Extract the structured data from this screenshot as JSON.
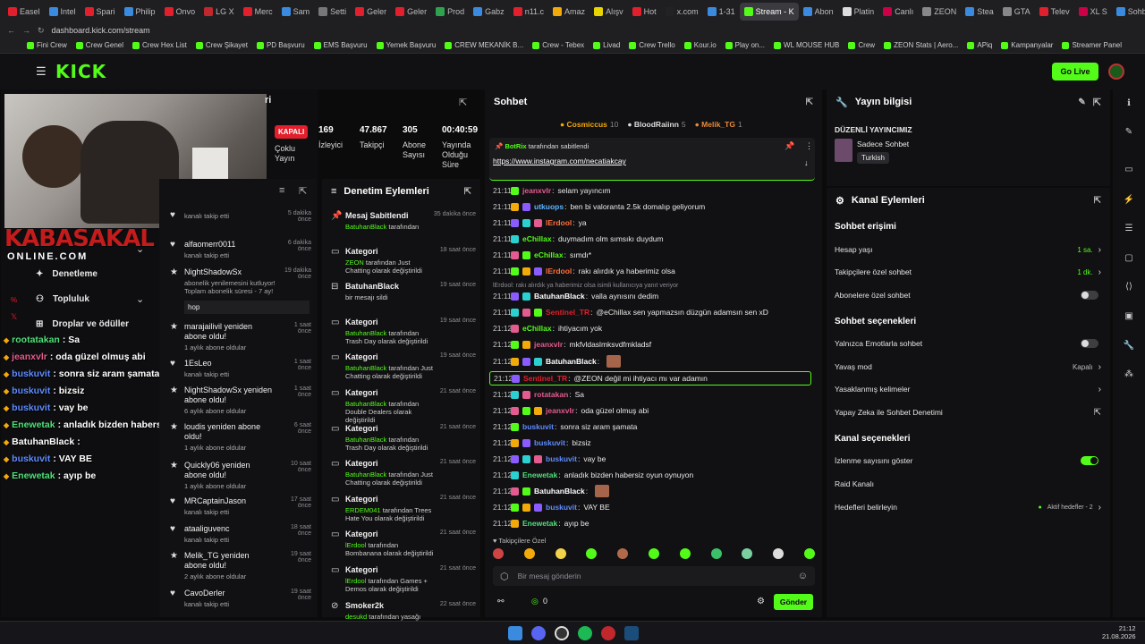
{
  "browser": {
    "tabs": [
      "Easel",
      "Intel",
      "Spari",
      "Philip",
      "Onvo",
      "LG X",
      "Merc",
      "Sam",
      "Setti",
      "Geler",
      "Geler",
      "Prod",
      "Gabz",
      "n11.c",
      "Amaz",
      "Alışv",
      "Hot",
      "x.com",
      "1-31",
      "Stream - K",
      "Abon",
      "Platin",
      "Canlı",
      "ZEON",
      "Stea",
      "GTA",
      "Telev",
      "XL S",
      "Sohb"
    ],
    "active_tab": "Stream - K",
    "url": "dashboard.kick.com/stream",
    "bookmarks": [
      "Fini Crew",
      "Crew Genel",
      "Crew Hex List",
      "Crew Şikayet",
      "PD Başvuru",
      "EMS Başvuru",
      "Yemek Başvuru",
      "CREW MEKANİK B...",
      "Crew - Tebex",
      "Livad",
      "Crew Trello",
      "Kour.io",
      "Play on...",
      "WL MOUSE HUB",
      "Crew",
      "ZEON Stats | Aero...",
      "APiq",
      "Kampanyalar",
      "Streamer Panel"
    ]
  },
  "header": {
    "logo": "KICK",
    "go_live": "Go Live"
  },
  "stream_stats": {
    "status": "KAPALI",
    "status_label": "Çoklu Yayın",
    "viewers": "169",
    "viewers_label": "İzleyici",
    "followers": "47.867",
    "followers_label": "Takipçi",
    "subs": "305",
    "subs_label": "Abone Sayısı",
    "duration": "00:40:59",
    "duration_label": "Yayında Olduğu Süre"
  },
  "sidebar": {
    "items": [
      "Denetleme",
      "Topluluk",
      "Droplar ve ödüller"
    ]
  },
  "activity_feed": [
    {
      "title": "",
      "sub": "kanalı takip etti",
      "time": "5 dakika önce"
    },
    {
      "title": "alfaomerr0011",
      "sub": "kanalı takip etti",
      "time": "6 dakika önce"
    },
    {
      "title": "NightShadowSx",
      "sub": "abonelik yenilemesini kutluyor! Toplam abonelik süresi - 7 ay!",
      "time": "19 dakika önce",
      "msg": "hop"
    },
    {
      "title": "marajailivil yeniden abone oldu!",
      "sub": "1 aylık abone oldular",
      "time": "1 saat önce"
    },
    {
      "title": "1EsLeo",
      "sub": "kanalı takip etti",
      "time": "1 saat önce"
    },
    {
      "title": "NightShadowSx yeniden abone oldu!",
      "sub": "6 aylık abone oldular",
      "time": "1 saat önce"
    },
    {
      "title": "loudis yeniden abone oldu!",
      "sub": "1 aylık abone oldular",
      "time": "6 saat önce"
    },
    {
      "title": "Quickly06 yeniden abone oldu!",
      "sub": "1 aylık abone oldular",
      "time": "10 saat önce"
    },
    {
      "title": "MRCaptainJason",
      "sub": "kanalı takip etti",
      "time": "17 saat önce"
    },
    {
      "title": "ataaliguvenc",
      "sub": "kanalı takip etti",
      "time": "18 saat önce"
    },
    {
      "title": "Melik_TG yeniden abone oldu!",
      "sub": "2 aylık abone oldular",
      "time": "19 saat önce"
    },
    {
      "title": "CavoDerler",
      "sub": "kanalı takip etti",
      "time": "19 saat önce"
    }
  ],
  "moderation": {
    "title": "Denetim Eylemleri",
    "items": [
      {
        "title": "Mesaj Sabitlendi",
        "user": "BatuhanBlack",
        "rest": " tarafından",
        "time": "35 dakika önce"
      },
      {
        "title": "Kategori",
        "user": "ZEON",
        "rest": " tarafından Just Chatting olarak değiştirildi",
        "time": "18 saat önce"
      },
      {
        "title": "BatuhanBlack",
        "user": "",
        "rest": "bir mesajı sildi",
        "time": "19 saat önce"
      },
      {
        "title": "Kategori",
        "user": "BatuhanBlack",
        "rest": " tarafından Trash Day olarak değiştirildi",
        "time": "19 saat önce"
      },
      {
        "title": "Kategori",
        "user": "BatuhanBlack",
        "rest": " tarafından Just Chatting olarak değiştirildi",
        "time": "19 saat önce"
      },
      {
        "title": "Kategori",
        "user": "BatuhanBlack",
        "rest": " tarafından Double Dealers olarak değiştirildi",
        "time": "21 saat önce"
      },
      {
        "title": "Kategori",
        "user": "BatuhanBlack",
        "rest": " tarafından Trash Day olarak değiştirildi",
        "time": "21 saat önce"
      },
      {
        "title": "Kategori",
        "user": "BatuhanBlack",
        "rest": " tarafından Just Chatting olarak değiştirildi",
        "time": "21 saat önce"
      },
      {
        "title": "Kategori",
        "user": "ERDEM041",
        "rest": " tarafından Trees Hate You olarak değiştirildi",
        "time": "21 saat önce"
      },
      {
        "title": "Kategori",
        "user": "lErdool",
        "rest": " tarafından Bombanana olarak değiştirildi",
        "time": "21 saat önce"
      },
      {
        "title": "Kategori",
        "user": "lErdool",
        "rest": " tarafından Games + Demos olarak değiştirildi",
        "time": "21 saat önce"
      },
      {
        "title": "Smoker2k",
        "user": "desukd",
        "rest": " tarafından yasağı kaldırıldı",
        "time": "22 saat önce"
      }
    ]
  },
  "chat": {
    "title": "Sohbet",
    "top_gifters": [
      {
        "name": "Cosmiccus",
        "count": "10"
      },
      {
        "name": "BloodRaiinn",
        "count": "5"
      },
      {
        "name": "Melik_TG",
        "count": "1"
      }
    ],
    "pinned": {
      "by": "BotRix",
      "by_suffix": "tarafından sabitlendi",
      "link": "https://www.instagram.com/necatiakcay"
    },
    "messages": [
      {
        "time": "21:11",
        "user": "jeanxvlr",
        "color": "#e45b8f",
        "text": "selam yayıncım"
      },
      {
        "time": "21:11",
        "user": "utkuops",
        "color": "#5eb3ff",
        "text": "ben bi valoranta 2.5k domalıp geliyorum"
      },
      {
        "time": "21:11",
        "user": "lErdool",
        "color": "#ff6f3c",
        "text": "ya"
      },
      {
        "time": "21:11",
        "user": "eChillax",
        "color": "#53fc18",
        "text": "duymadım olm sımsıkı duydum"
      },
      {
        "time": "21:11",
        "user": "eChillax",
        "color": "#53fc18",
        "text": "sımdı*"
      },
      {
        "time": "21:11",
        "user": "lErdool",
        "color": "#ff6f3c",
        "text": "rakı alırdık ya haberimiz olsa"
      },
      {
        "time": "",
        "user": "",
        "color": "#888",
        "text": "lErdool: rakı alırdık ya haberimiz olsa isimli kullanıcıya yanıt veriyor"
      },
      {
        "time": "21:11",
        "user": "BatuhanBlack",
        "color": "#fff",
        "text": "valla aynısını dedim"
      },
      {
        "time": "21:11",
        "user": "Sentinel_TR",
        "color": "#e21f2c",
        "text": "@eChillax sen yapmazsın düzgün adamsın sen xD"
      },
      {
        "time": "21:12",
        "user": "eChillax",
        "color": "#53fc18",
        "text": "ihtiyacım yok"
      },
      {
        "time": "21:12",
        "user": "jeanxvlr",
        "color": "#e45b8f",
        "text": "mkfvldaslmksvdfmkladsf"
      },
      {
        "time": "21:12",
        "user": "BatuhanBlack",
        "color": "#fff",
        "text": ""
      },
      {
        "time": "21:12",
        "user": "Sentinel_TR",
        "color": "#e21f2c",
        "text": "@ZEON değil mi ihtiyacı mı var adamın"
      },
      {
        "time": "21:12",
        "user": "rotatakan",
        "color": "#e45b8f",
        "text": "Sa"
      },
      {
        "time": "21:12",
        "user": "jeanxvlr",
        "color": "#e45b8f",
        "text": "oda güzel olmuş abi"
      },
      {
        "time": "21:12",
        "user": "buskuvit",
        "color": "#5e8bff",
        "text": "sonra siz aram şamata"
      },
      {
        "time": "21:12",
        "user": "buskuvit",
        "color": "#5e8bff",
        "text": "bizsiz"
      },
      {
        "time": "21:12",
        "user": "buskuvit",
        "color": "#5e8bff",
        "text": "vay be"
      },
      {
        "time": "21:12",
        "user": "Enewetak",
        "color": "#4fe07a",
        "text": "anladık bizden habersiz oyun oynuyon"
      },
      {
        "time": "21:12",
        "user": "BatuhanBlack",
        "color": "#fff",
        "text": ""
      },
      {
        "time": "21:12",
        "user": "buskuvit",
        "color": "#5e8bff",
        "text": "VAY BE"
      },
      {
        "time": "21:12",
        "user": "Enewetak",
        "color": "#4fe07a",
        "text": "ayıp be"
      }
    ],
    "emote_label": "Takipçilere Özel",
    "input_placeholder": "Bir mesaj gönderin",
    "points": "0",
    "send": "Gönder"
  },
  "stream_info": {
    "title": "Yayın bilgisi",
    "stream_title": "DÜZENLİ YAYINCIMIZ",
    "category": "Sadece Sohbet",
    "language": "Turkish"
  },
  "channel_actions": {
    "title": "Kanal Eylemleri",
    "chat_access": "Sohbet erişimi",
    "account_age": "Hesap yaşı",
    "account_age_val": "1 sa.",
    "follower_only": "Takipçilere özel sohbet",
    "follower_only_val": "1 dk.",
    "sub_only": "Abonelere özel sohbet",
    "chat_options": "Sohbet seçenekleri",
    "emote_only": "Yalnızca Emotlarla sohbet",
    "slow_mode": "Yavaş mod",
    "slow_mode_val": "Kapalı",
    "banned_words": "Yasaklanmış kelimeler",
    "ai_mod": "Yapay Zeka ile Sohbet Denetimi",
    "channel_options": "Kanal seçenekleri",
    "show_viewers": "İzlenme sayısını göster",
    "raid": "Raid Kanalı",
    "goals": "Hedefleri belirleyin",
    "goals_val": "Aktif hedefler - 2"
  },
  "overlay": {
    "brand": "KABASAKAL",
    "brand_sub": "ONLINE.COM",
    "messages": [
      {
        "user": "rootatakan",
        "color": "#4fe07a",
        "text": ": Sa"
      },
      {
        "user": "jeanxvlr",
        "color": "#e45b8f",
        "text": ": oda güzel olmuş abi"
      },
      {
        "user": "buskuvit",
        "color": "#5e8bff",
        "text": ": sonra siz aram şamata"
      },
      {
        "user": "buskuvit",
        "color": "#5e8bff",
        "text": ": bizsiz"
      },
      {
        "user": "buskuvit",
        "color": "#5e8bff",
        "text": ": vay be"
      },
      {
        "user": "Enewetak",
        "color": "#4fe07a",
        "text": ": anladık bizden habersiz oyun oynuyon"
      },
      {
        "user": "BatuhanBlack",
        "color": "#fff",
        "text": ":"
      },
      {
        "user": "buskuvit",
        "color": "#5e8bff",
        "text": ": VAY BE"
      },
      {
        "user": "Enewetak",
        "color": "#4fe07a",
        "text": ": ayıp be"
      }
    ]
  },
  "taskbar": {
    "time": "21:12",
    "date": "21.08.2026"
  }
}
